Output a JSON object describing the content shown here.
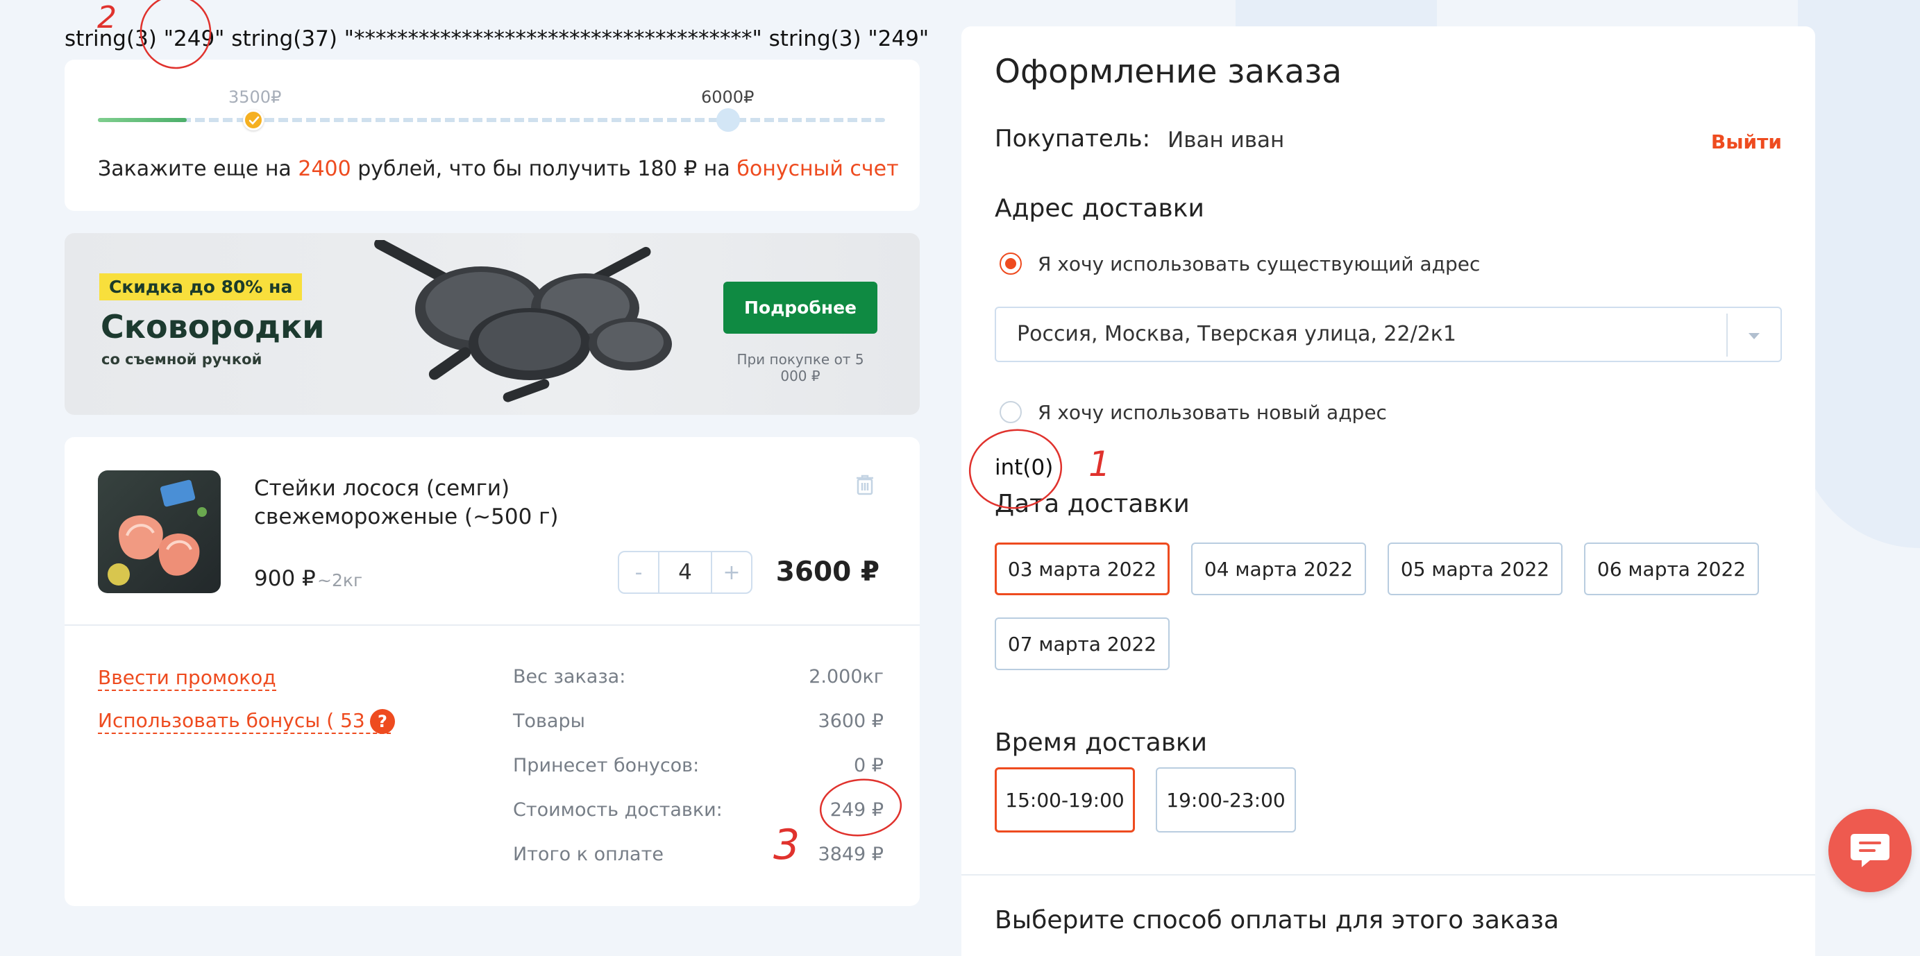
{
  "debug": {
    "top_line": "string(3) \"249\" string(37) \"*************************************\" string(3) \"249\"",
    "int_line": "int(0)"
  },
  "bonus_progress": {
    "mark1": "3500₽",
    "mark2": "6000₽",
    "fill_fraction": 0.113,
    "text_before": "Закажите еще на ",
    "amount": "2400",
    "text_middle": " рублей, что бы получить 180 ₽ на ",
    "bonus_link": "бонусный счет"
  },
  "banner": {
    "badge": "Скидка до 80% на",
    "title": "Сковородки",
    "subtitle": "со съемной ручкой",
    "button": "Подробнее",
    "note": "При покупке от 5 000 ₽"
  },
  "cart": {
    "product_name": "Стейки лосося (семги) свежемороженые (~500 г)",
    "price": "900 ₽",
    "weight": "~2кг",
    "quantity": "4",
    "minus": "-",
    "plus": "+",
    "line_total": "3600 ₽",
    "promo_link": "Ввести промокод",
    "bonus_link": "Использовать бонусы ( 53 ₽)",
    "help": "?",
    "summary": [
      {
        "label": "Вес заказа:",
        "value": "2.000кг"
      },
      {
        "label": "Товары",
        "value": "3600 ₽"
      },
      {
        "label": "Принесет бонусов:",
        "value": "0 ₽"
      },
      {
        "label": "Стоимость доставки:",
        "value": "249 ₽"
      },
      {
        "label": "Итого к оплате",
        "value": "3849 ₽"
      }
    ]
  },
  "checkout": {
    "title": "Оформление заказа",
    "buyer_label": "Покупатель:",
    "buyer_name": "Иван иван",
    "logout": "Выйти",
    "address_heading": "Адрес доставки",
    "opt_existing": "Я хочу использовать существующий адрес",
    "address_value": "Россия, Москва, Тверская улица, 22/2к1",
    "opt_new": "Я хочу использовать новый адрес",
    "date_heading": "Дата доставки",
    "dates": [
      "03 марта 2022",
      "04 марта 2022",
      "05 марта 2022",
      "06 марта 2022",
      "07 марта 2022"
    ],
    "time_heading": "Время доставки",
    "times": [
      "15:00-19:00",
      "19:00-23:00"
    ],
    "payment_heading": "Выберите способ оплаты для этого заказа"
  },
  "annotations": [
    "2",
    "1",
    "3"
  ],
  "colors": {
    "accent": "#ee4b1f",
    "green_button": "#0f8a42",
    "background": "#f1f5fa"
  }
}
